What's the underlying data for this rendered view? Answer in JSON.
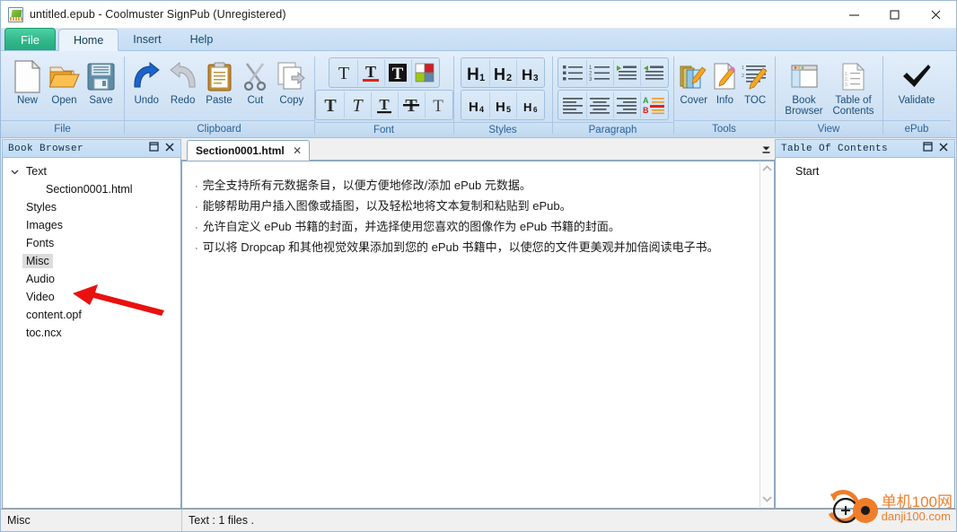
{
  "window": {
    "title": "untitled.epub - Coolmuster SignPub (Unregistered)",
    "app_icon": "epub-document-icon",
    "minimize_label": "─",
    "maximize_label": "□",
    "close_label": "✕"
  },
  "tabs": [
    {
      "label": "File",
      "name": "tab-file",
      "state": "file"
    },
    {
      "label": "Home",
      "name": "tab-home",
      "state": "active"
    },
    {
      "label": "Insert",
      "name": "tab-insert",
      "state": "normal"
    },
    {
      "label": "Help",
      "name": "tab-help",
      "state": "normal"
    }
  ],
  "ribbon": {
    "groups": [
      {
        "label": "File",
        "name": "ribbon-group-file",
        "buttons": [
          {
            "label": "New",
            "icon": "new-document-icon"
          },
          {
            "label": "Open",
            "icon": "open-folder-icon"
          },
          {
            "label": "Save",
            "icon": "floppy-disk-icon"
          }
        ]
      },
      {
        "label": "Clipboard",
        "name": "ribbon-group-clipboard",
        "buttons": [
          {
            "label": "Undo",
            "icon": "undo-arrow-icon"
          },
          {
            "label": "Redo",
            "icon": "redo-arrow-icon"
          },
          {
            "label": "Paste",
            "icon": "clipboard-icon"
          },
          {
            "label": "Cut",
            "icon": "scissors-icon"
          },
          {
            "label": "Copy",
            "icon": "copy-pages-icon"
          }
        ]
      },
      {
        "label": "Font",
        "name": "ribbon-group-font",
        "row1": [
          {
            "icon": "text-plain-icon",
            "title": "T"
          },
          {
            "icon": "text-underline-red-icon",
            "title": "T"
          },
          {
            "icon": "text-highlight-icon",
            "title": "T"
          },
          {
            "icon": "text-color-palette-icon",
            "title": ""
          }
        ],
        "row2": [
          {
            "icon": "bold-icon",
            "title": "T"
          },
          {
            "icon": "italic-icon",
            "title": "T"
          },
          {
            "icon": "underline-icon",
            "title": "T"
          },
          {
            "icon": "strikethrough-icon",
            "title": "T"
          },
          {
            "icon": "normal-text-icon",
            "title": "T"
          }
        ]
      },
      {
        "label": "Styles",
        "name": "ribbon-group-styles",
        "row1": [
          {
            "icon": "heading-1-icon",
            "title": "H",
            "sub": "1"
          },
          {
            "icon": "heading-2-icon",
            "title": "H",
            "sub": "2"
          },
          {
            "icon": "heading-3-icon",
            "title": "H",
            "sub": "3"
          }
        ],
        "row2": [
          {
            "icon": "heading-4-icon",
            "title": "H",
            "sub": "4"
          },
          {
            "icon": "heading-5-icon",
            "title": "H",
            "sub": "5"
          },
          {
            "icon": "heading-6-icon",
            "title": "H",
            "sub": "6"
          }
        ]
      },
      {
        "label": "Paragraph",
        "name": "ribbon-group-paragraph",
        "row1": [
          {
            "icon": "bullet-list-icon"
          },
          {
            "icon": "numbered-list-icon"
          },
          {
            "icon": "increase-indent-icon"
          },
          {
            "icon": "decrease-indent-icon"
          }
        ],
        "row2": [
          {
            "icon": "align-left-icon"
          },
          {
            "icon": "align-center-icon"
          },
          {
            "icon": "align-right-icon"
          },
          {
            "icon": "dropcap-icon"
          }
        ]
      },
      {
        "label": "Tools",
        "name": "ribbon-group-tools",
        "buttons": [
          {
            "label": "Cover",
            "icon": "cover-edit-icon"
          },
          {
            "label": "Info",
            "icon": "metadata-edit-icon"
          },
          {
            "label": "TOC",
            "icon": "toc-edit-icon"
          }
        ]
      },
      {
        "label": "View",
        "name": "ribbon-group-view",
        "buttons": [
          {
            "label": "Book\nBrowser",
            "line1": "Book",
            "line2": "Browser",
            "icon": "book-browser-icon"
          },
          {
            "label": "Table of\nContents",
            "line1": "Table of",
            "line2": "Contents",
            "icon": "table-of-contents-icon"
          }
        ]
      },
      {
        "label": "ePub",
        "name": "ribbon-group-epub",
        "buttons": [
          {
            "label": "Validate",
            "icon": "checkmark-icon"
          }
        ]
      }
    ]
  },
  "book_browser": {
    "title": "Book Browser",
    "restore_glyph": "❐",
    "close_glyph": "✕",
    "tree": [
      {
        "label": "Text",
        "level": 0,
        "expanded": true,
        "selected": false
      },
      {
        "label": "Section0001.html",
        "level": 2,
        "expanded": false,
        "selected": false
      },
      {
        "label": "Styles",
        "level": 1,
        "expanded": false,
        "selected": false
      },
      {
        "label": "Images",
        "level": 1,
        "expanded": false,
        "selected": false
      },
      {
        "label": "Fonts",
        "level": 1,
        "expanded": false,
        "selected": false
      },
      {
        "label": "Misc",
        "level": 1,
        "expanded": false,
        "selected": true
      },
      {
        "label": "Audio",
        "level": 1,
        "expanded": false,
        "selected": false
      },
      {
        "label": "Video",
        "level": 1,
        "expanded": false,
        "selected": false
      },
      {
        "label": "content.opf",
        "level": 1,
        "expanded": false,
        "selected": false
      },
      {
        "label": "toc.ncx",
        "level": 1,
        "expanded": false,
        "selected": false
      }
    ]
  },
  "editor": {
    "doc_tab": {
      "label": "Section0001.html",
      "close_glyph": "✕"
    },
    "tab_overflow_glyph": "▼",
    "bullet": "·",
    "lines": [
      "完全支持所有元数据条目，以便方便地修改/添加 ePub 元数据。",
      "能够帮助用户插入图像或插图，以及轻松地将文本复制和粘贴到 ePub。",
      "允许自定义 ePub 书籍的封面，并选择使用您喜欢的图像作为 ePub 书籍的封面。",
      "可以将 Dropcap 和其他视觉效果添加到您的 ePub 书籍中，以使您的文件更美观并加倍阅读电子书。"
    ],
    "scroll_up_glyph": "⌃",
    "scroll_down_glyph": "⌄"
  },
  "table_of_contents": {
    "title": "Table Of Contents",
    "restore_glyph": "❐",
    "close_glyph": "✕",
    "items": [
      {
        "label": "Start"
      }
    ]
  },
  "statusbar": {
    "left": "Misc",
    "right": "Text : 1 files ."
  },
  "watermark": {
    "cn": "单机100网",
    "en": "danji100.com",
    "color": "#f07d28",
    "icon": "danji100-logo-icon"
  },
  "annotation": {
    "arrow": "red-pointer-arrow",
    "color": "#e8110f",
    "points_at": "Video"
  },
  "colors": {
    "file_tab": "#2fbd8f",
    "ribbon_bg": "#d3e4f5",
    "panel_header": "#c6dff5",
    "selection": "#dcdcdc",
    "accent_text": "#2a6099"
  }
}
